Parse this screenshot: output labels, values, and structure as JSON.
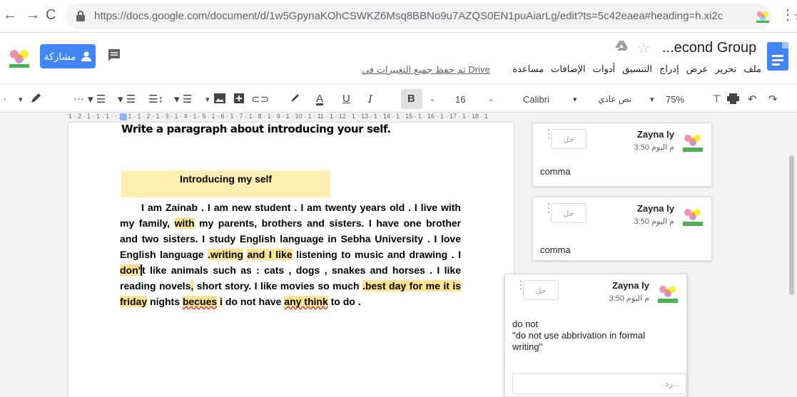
{
  "browser": {
    "url": "https://docs.google.com/document/d/1w5GpynaKOhCSWKZ6Msq8BBNo9u7AZQS0EN1puAiarLg/edit?ts=5c42eaea#heading=h.xi2cl...",
    "back_glyph": "←",
    "forward_glyph": "→",
    "reload_glyph": "C",
    "star_glyph": "☆",
    "menu_glyph": "⋮"
  },
  "header": {
    "title": "...econd Group",
    "share_label": "مشاركة",
    "saved_status": "تم حفظ جميع التغييرات في Drive",
    "menu": [
      "ملف",
      "تحرير",
      "عرض",
      "إدراج",
      "التنسيق",
      "أدوات",
      "الإضافات",
      "مساعدة"
    ]
  },
  "toolbar": {
    "zoom": "75%",
    "style": "نص عادي",
    "font": "Calibri",
    "font_size": "16",
    "bold": "B",
    "italic": "I",
    "underline": "U",
    "text_color": "A",
    "more": "···"
  },
  "ruler": {
    "text": "1 · 2 · 1 · 1 · 1 ·   · 1 · 1 · 1 · 2 · 1 · 3 · 1 · 4 · 1 · 5 · 1 · 6 · 1 · 7 · 1 · 8 · 1 · 9 · 1 · 10 · 1 · 11 · 1 · 12 · 1 · 13 · 1 · 14 · 1 · 15 · 1 · 16 · 1 · 17 · 1 · 18 · 1"
  },
  "document": {
    "prompt": "Write a paragraph about introducing your self.",
    "heading": "Introducing my self",
    "p1": "I am Zainab . I am new student . I am twenty years old  . I live with my family, ",
    "h_with": "with",
    "p2": " my parents, brothers and sisters. I have one brother and two sisters. I study English language in Sebha University . I love English language ",
    "h_writing": ".writing",
    "p3": " ",
    "h_and_i_like": "and I like",
    "p4": " listening to music  and drawing . I ",
    "h_don": "don'",
    "p5": "t like animals such as : cats , dogs , snakes and horses   . I like reading novels",
    "h_comma": ",",
    "p6": " short story.  I like movies so much ",
    "h_best": ".best day for me it is friday",
    "p7": " nights ",
    "h_becues": "becues",
    "p8": " ",
    "h_i": "i",
    "p9": " do not have ",
    "h_any_think": "any think",
    "p10": " to do ."
  },
  "comments": [
    {
      "resolve": "حل",
      "author": "Zayna ly",
      "time": "3:50 م اليوم",
      "body": "comma"
    },
    {
      "resolve": "حل",
      "author": "Zayna ly",
      "time": "3:50 م اليوم",
      "body": "comma"
    },
    {
      "resolve": "حل",
      "author": "Zayna ly",
      "time": "3:50 م اليوم",
      "body_line1": "do not",
      "body_line2": "\"do not use abbrivation in formal",
      "body_line3": "writing\"",
      "reply_placeholder": "رد..."
    }
  ],
  "colors": {
    "highlight": "#fde293",
    "heading_highlight": "#fdeeb1",
    "share_button": "#4285f4",
    "docs_blue": "#4285f4"
  }
}
